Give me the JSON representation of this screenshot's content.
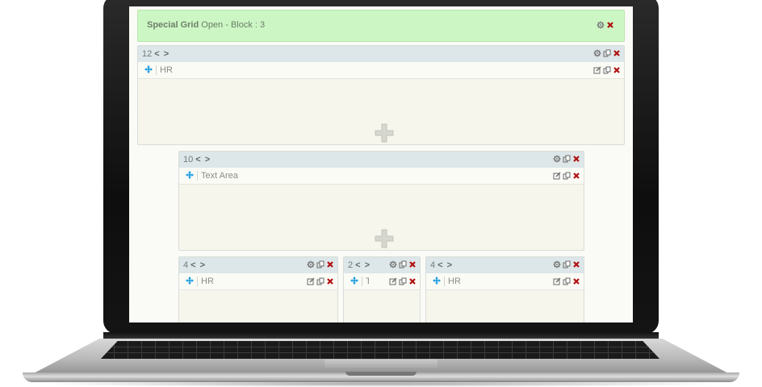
{
  "banner": {
    "title_bold": "Special Grid",
    "title_rest": " Open - Block : 3"
  },
  "blocks": {
    "b12": {
      "size": "12",
      "nav": "< >",
      "row_label": "HR"
    },
    "b10": {
      "size": "10",
      "nav": "< >",
      "row_label": "Text Area"
    },
    "b4a": {
      "size": "4",
      "nav": "< >",
      "row_label": "HR"
    },
    "b2": {
      "size": "2",
      "nav": "< >",
      "row_label": "T"
    },
    "b4b": {
      "size": "4",
      "nav": "< >",
      "row_label": "HR"
    }
  },
  "icons": {
    "settings": "gear-icon",
    "copy": "copy-icon",
    "delete": "close-icon",
    "edit": "edit-icon",
    "move": "move-icon",
    "add": "plus-icon"
  },
  "colors": {
    "banner_bg": "#ccf7c4",
    "header_bg": "#dde6e8",
    "delete_red": "#b01010",
    "move_blue": "#1a9be0"
  }
}
